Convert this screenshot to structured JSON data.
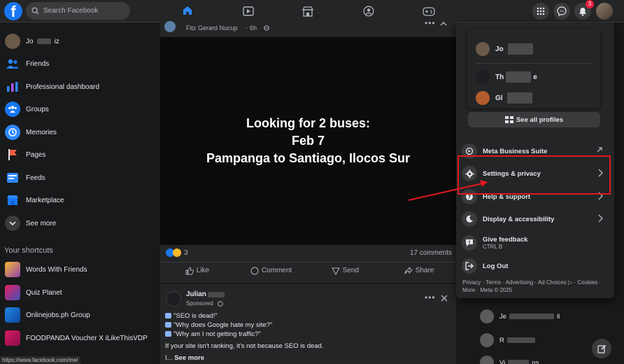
{
  "topbar": {
    "search_placeholder": "Search Facebook",
    "notification_count": "3"
  },
  "sidebar": {
    "profile_name_start": "Jo",
    "profile_name_end": "iz",
    "items": [
      {
        "label": "Friends",
        "icon": "friends-icon"
      },
      {
        "label": "Professional dashboard",
        "icon": "dashboard-icon"
      },
      {
        "label": "Groups",
        "icon": "groups-icon"
      },
      {
        "label": "Memories",
        "icon": "memories-icon"
      },
      {
        "label": "Pages",
        "icon": "pages-icon"
      },
      {
        "label": "Feeds",
        "icon": "feeds-icon"
      },
      {
        "label": "Marketplace",
        "icon": "marketplace-icon"
      },
      {
        "label": "See more",
        "icon": "chevron-down-icon"
      }
    ],
    "shortcuts_heading": "Your shortcuts",
    "shortcuts": [
      {
        "label": "Words With Friends"
      },
      {
        "label": "Quiz Planet"
      },
      {
        "label": "Onlinejobs.ph Group"
      },
      {
        "label": "FOODPANDA Voucher X iLikeThisVDP"
      }
    ]
  },
  "post1": {
    "author": "Fitz Gerard Nucup",
    "time": "6h",
    "image_lines": [
      "Looking for 2 buses:",
      "Feb 7",
      "Pampanga to Santiago, Ilocos Sur"
    ],
    "reaction_count": "3",
    "comments": "17 comments",
    "actions": {
      "like": "Like",
      "comment": "Comment",
      "send": "Send",
      "share": "Share"
    }
  },
  "post2": {
    "author": "Julian",
    "sponsored": "Sponsored",
    "lines": [
      "\"SEO is dead!\"",
      "\"Why does Google hate my site?\"",
      "\"Why am I not getting traffic?\""
    ],
    "body": "If your site isn't ranking, it's not because SEO is dead.",
    "more_prefix": "I...",
    "see_more": "See more"
  },
  "menu": {
    "profiles": [
      {
        "name_start": "Jo",
        "name_end": ""
      },
      {
        "name_start": "Th",
        "name_end": "e"
      },
      {
        "name_start": "Gl",
        "name_end": ""
      }
    ],
    "see_all": "See all profiles",
    "items": [
      {
        "label": "Meta Business Suite",
        "icon": "briefcase-icon"
      },
      {
        "label": "Settings & privacy",
        "icon": "gear-icon"
      },
      {
        "label": "Help & support",
        "icon": "question-icon"
      },
      {
        "label": "Display & accessibility",
        "icon": "moon-icon"
      },
      {
        "label": "Give feedback",
        "sub": "CTRL B",
        "icon": "feedback-icon"
      },
      {
        "label": "Log Out",
        "icon": "logout-icon"
      }
    ],
    "footer_line1": "Privacy · Terms · Advertising · Ad Choices ▷ · Cookies ·",
    "footer_line2": "More · Meta © 2025"
  },
  "contacts": [
    {
      "start": "Je",
      "end": "ll"
    },
    {
      "start": "R",
      "end": ""
    },
    {
      "start": "Vi",
      "end": "ns"
    }
  ],
  "status_url": "https://www.facebook.com/me/",
  "colors": {
    "accent": "#2d88ff",
    "highlight": "#e0191e",
    "brand": "#1877f2"
  }
}
